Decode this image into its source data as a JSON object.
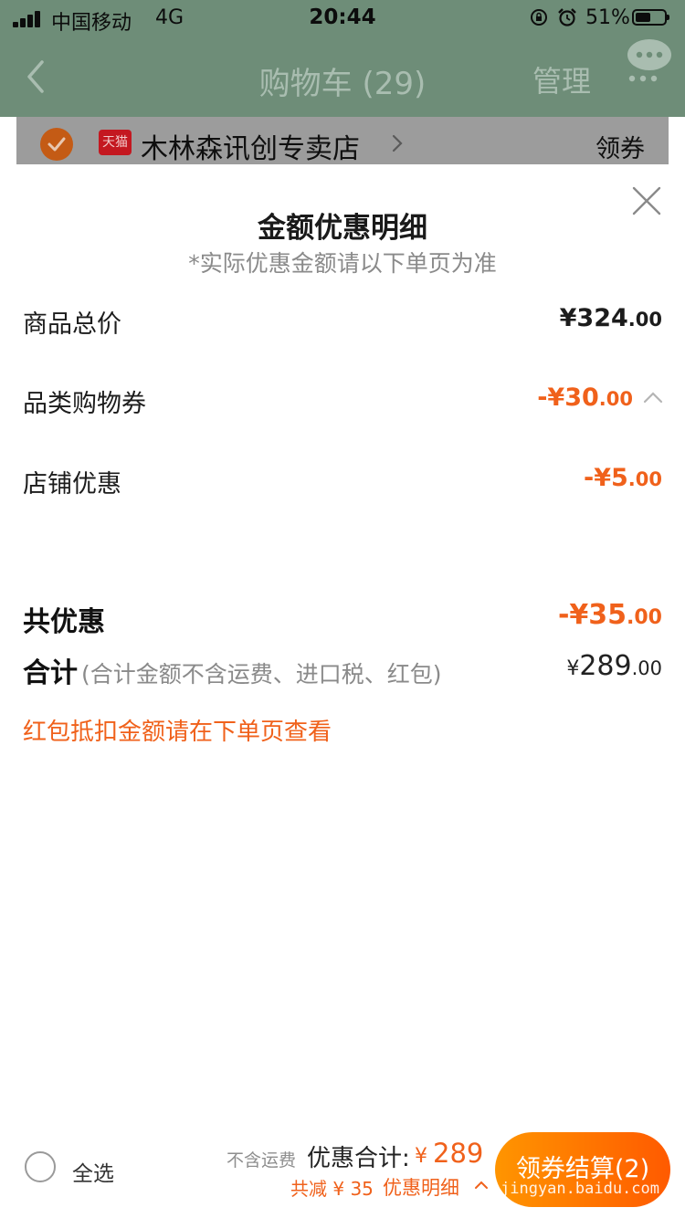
{
  "status_bar": {
    "carrier": "中国移动",
    "network": "4G",
    "time": "20:44",
    "battery": "51%"
  },
  "nav": {
    "title": "购物车 (29)",
    "manage": "管理"
  },
  "store": {
    "tmall_badge": "天猫",
    "name": "木林森讯创专卖店",
    "coupon": "领券"
  },
  "sheet": {
    "title": "金额优惠明细",
    "subtitle": "*实际优惠金额请以下单页为准",
    "rows": [
      {
        "label": "商品总价",
        "value_int": "¥324",
        "value_dec": ".00"
      },
      {
        "label": "品类购物券",
        "value_int": "-¥30",
        "value_dec": ".00"
      },
      {
        "label": "店铺优惠",
        "value_int": "-¥5",
        "value_dec": ".00"
      }
    ],
    "total_discount": {
      "label": "共优惠",
      "value_int": "-¥35",
      "value_dec": ".00"
    },
    "sum": {
      "label": "合计",
      "note": "(合计金额不含运费、进口税、红包)",
      "currency": "¥",
      "value_int": "289",
      "value_dec": ".00"
    },
    "redpack_note": "红包抵扣金额请在下单页查看"
  },
  "bottom_bar": {
    "select_all": "全选",
    "no_shipping": "不含运费",
    "discount_total_label": "优惠合计:",
    "discount_total_currency": "¥",
    "discount_total_value": "289",
    "reduced": "共减 ¥ 35",
    "detail_link": "优惠明细",
    "checkout": "领券结算(2)",
    "watermark": "jingyan.baidu.com"
  },
  "colors": {
    "accent": "#f0611b",
    "overlay": "#6e8d78"
  }
}
